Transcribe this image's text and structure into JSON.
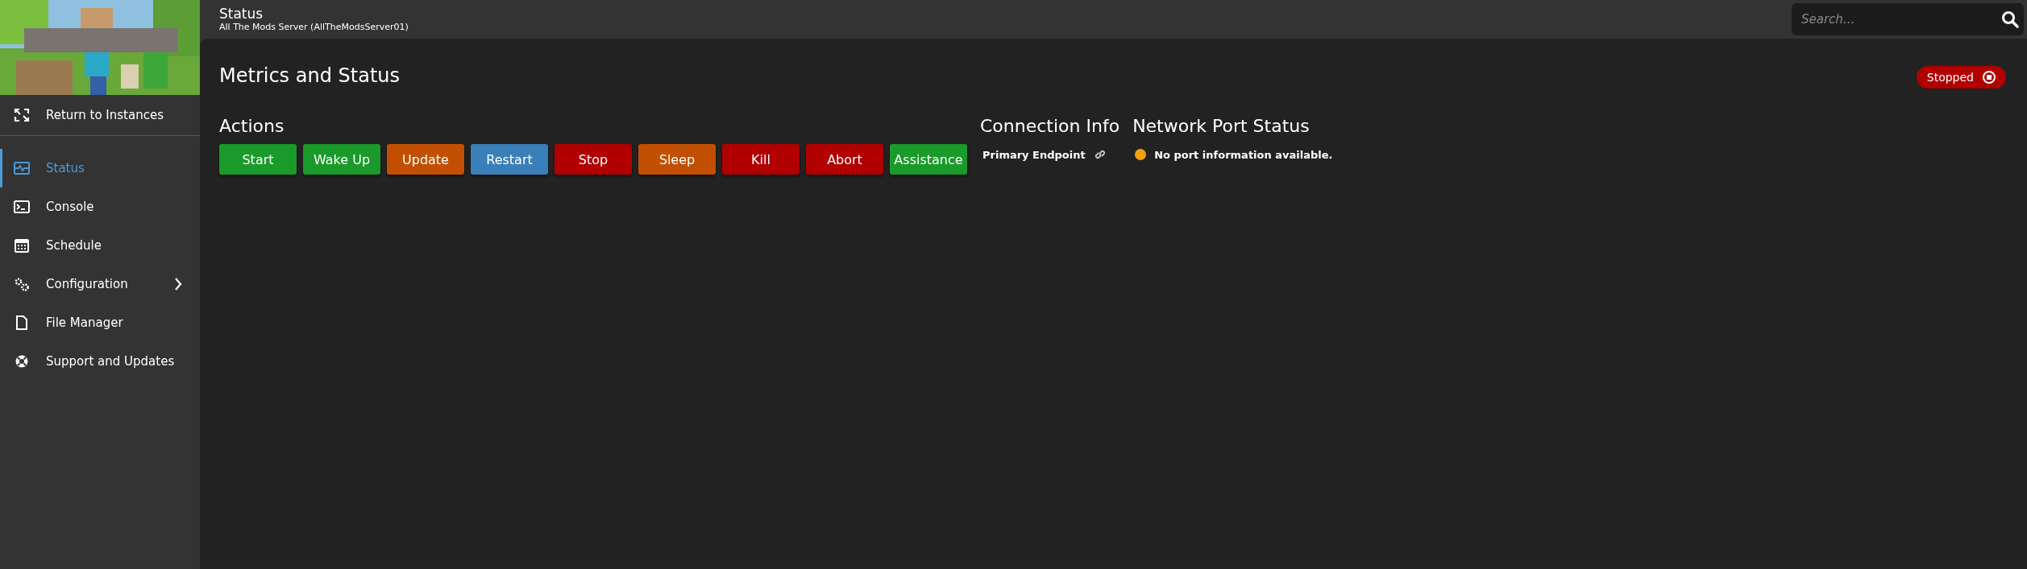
{
  "sidebar": {
    "back_item": {
      "label": "Return to Instances"
    },
    "items": [
      {
        "label": "Status",
        "selected": true,
        "has_submenu": false
      },
      {
        "label": "Console",
        "selected": false,
        "has_submenu": false
      },
      {
        "label": "Schedule",
        "selected": false,
        "has_submenu": false
      },
      {
        "label": "Configuration",
        "selected": false,
        "has_submenu": true
      },
      {
        "label": "File Manager",
        "selected": false,
        "has_submenu": false
      },
      {
        "label": "Support and Updates",
        "selected": false,
        "has_submenu": false
      }
    ]
  },
  "header": {
    "title": "Status",
    "subtitle": "All The Mods Server (AllTheModsServer01)"
  },
  "search": {
    "placeholder": "Search..."
  },
  "page": {
    "title": "Metrics and Status",
    "status_badge": "Stopped"
  },
  "actions": {
    "heading": "Actions",
    "buttons": [
      {
        "label": "Start",
        "color": "#1a9a2a"
      },
      {
        "label": "Wake Up",
        "color": "#1a9a2a"
      },
      {
        "label": "Update",
        "color": "#c24f00"
      },
      {
        "label": "Restart",
        "color": "#3a7fb8"
      },
      {
        "label": "Stop",
        "color": "#b00000"
      },
      {
        "label": "Sleep",
        "color": "#c24f00"
      },
      {
        "label": "Kill",
        "color": "#b00000"
      },
      {
        "label": "Abort",
        "color": "#b00000"
      },
      {
        "label": "Assistance",
        "color": "#1a9a2a"
      }
    ]
  },
  "connection_info": {
    "heading": "Connection Info",
    "endpoint": "Primary Endpoint"
  },
  "network_port_status": {
    "heading": "Network Port Status",
    "message": "No port information available.",
    "color": "#f0a000"
  }
}
